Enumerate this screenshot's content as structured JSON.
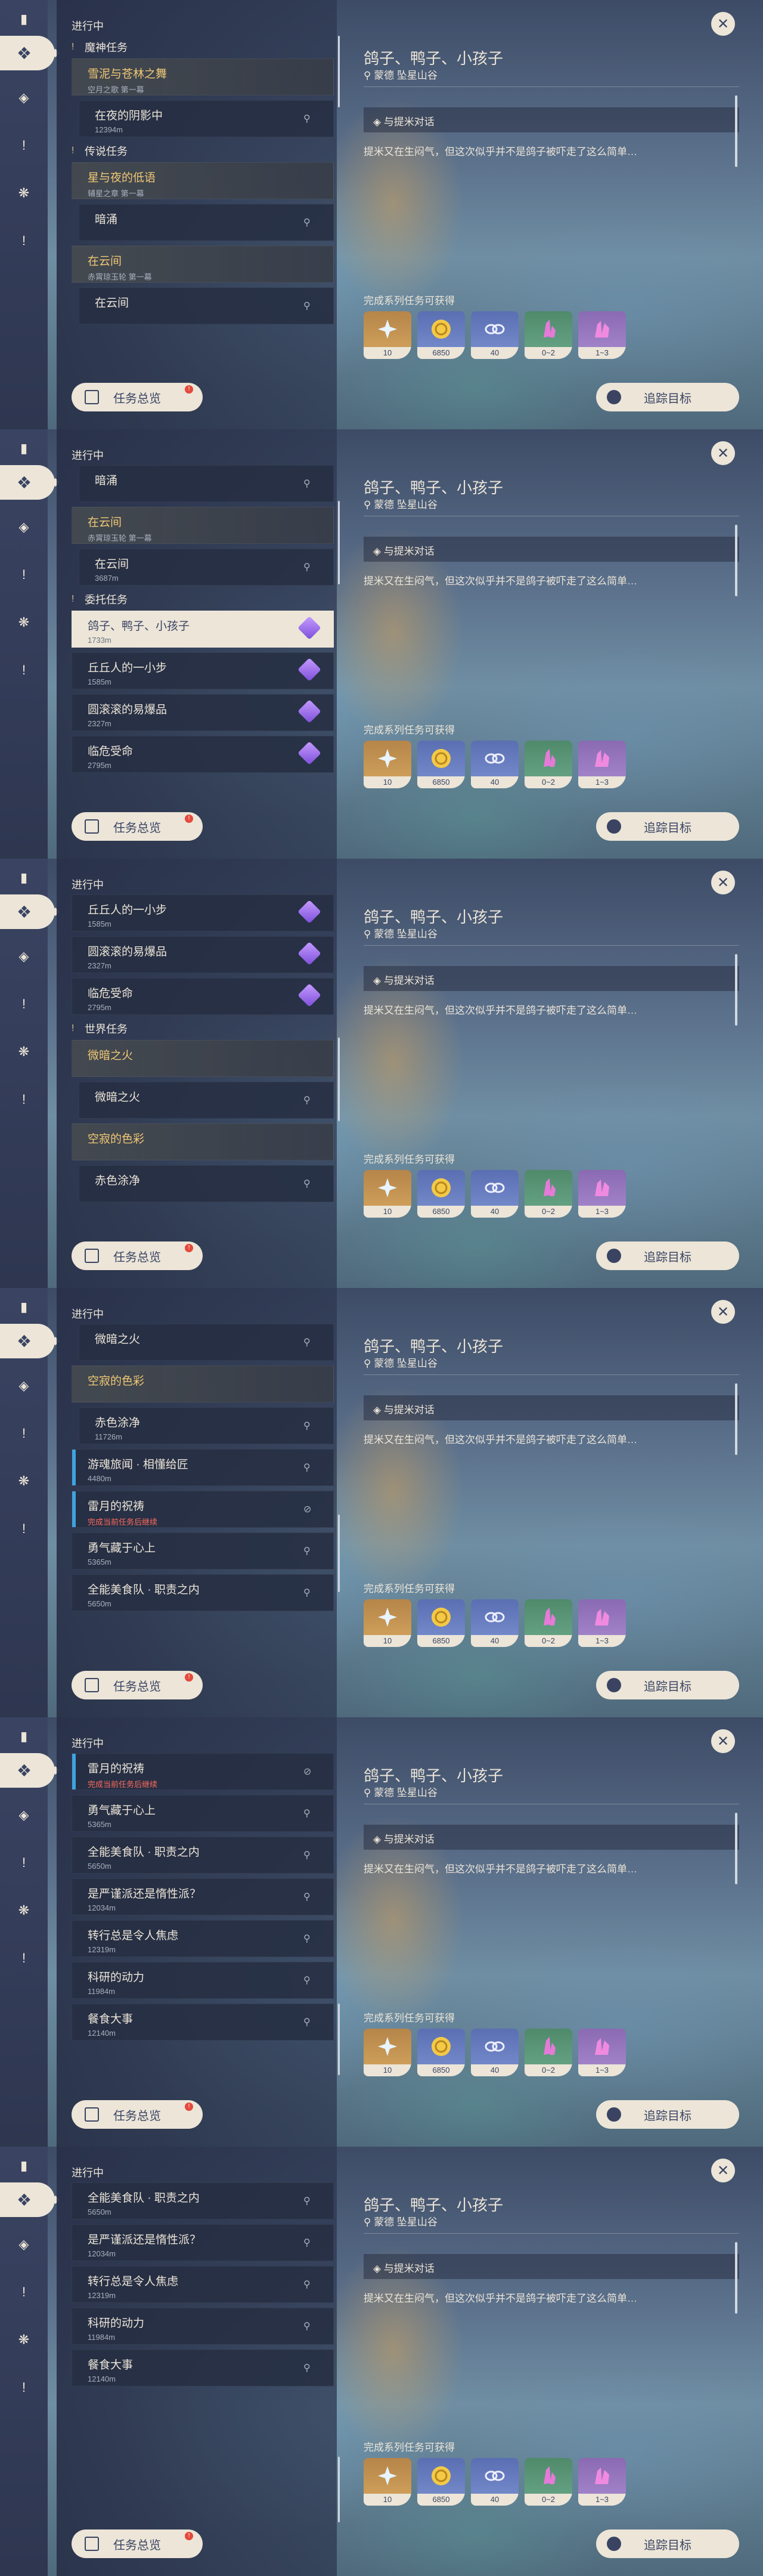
{
  "common": {
    "ongoing": "进行中",
    "tasks_button": "任务总览",
    "tasks_badge": "!",
    "track_button": "追踪目标",
    "close": "✕",
    "detail_title": "鸽子、鸭子、小孩子",
    "detail_location": "蒙德 坠星山谷",
    "objective": "与提米对话",
    "description": "提米又在生闷气，但这次似乎并不是鸽子被吓走了这么简单…",
    "rewards_title": "完成系列任务可获得",
    "rewards": [
      "10",
      "6850",
      "40",
      "0~2",
      "1~3"
    ]
  },
  "screens": [
    {
      "items": [
        {
          "kind": "sec",
          "label": "魔神任务"
        },
        {
          "kind": "story",
          "title": "雪泥与苍林之舞",
          "sub": "空月之歌 第一幕"
        },
        {
          "kind": "sub",
          "title": "在夜的阴影中",
          "sub": "12394m"
        },
        {
          "kind": "sec",
          "label": "传说任务"
        },
        {
          "kind": "story",
          "title": "星与夜的低语",
          "sub": "辅星之章 第一幕"
        },
        {
          "kind": "sub",
          "title": "暗涌",
          "sub": ""
        },
        {
          "kind": "story",
          "title": "在云间",
          "sub": "赤霄琼玉轮 第一幕"
        },
        {
          "kind": "sub",
          "title": "在云间",
          "sub": ""
        }
      ]
    },
    {
      "items": [
        {
          "kind": "sub",
          "title": "暗涌",
          "sub": ""
        },
        {
          "kind": "story",
          "title": "在云间",
          "sub": "赤霄琼玉轮 第一幕"
        },
        {
          "kind": "sub",
          "title": "在云间",
          "sub": "3687m"
        },
        {
          "kind": "sec",
          "label": "委托任务"
        },
        {
          "kind": "selgem",
          "title": "鸽子、鸭子、小孩子",
          "sub": "1733m"
        },
        {
          "kind": "gem",
          "title": "丘丘人的一小步",
          "sub": "1585m"
        },
        {
          "kind": "gem",
          "title": "圆滚滚的易爆品",
          "sub": "2327m"
        },
        {
          "kind": "gem",
          "title": "临危受命",
          "sub": "2795m"
        }
      ]
    },
    {
      "items": [
        {
          "kind": "gem",
          "title": "丘丘人的一小步",
          "sub": "1585m"
        },
        {
          "kind": "gem",
          "title": "圆滚滚的易爆品",
          "sub": "2327m"
        },
        {
          "kind": "gem",
          "title": "临危受命",
          "sub": "2795m"
        },
        {
          "kind": "sec",
          "label": "世界任务"
        },
        {
          "kind": "story",
          "title": "微暗之火",
          "sub": ""
        },
        {
          "kind": "sub",
          "title": "微暗之火",
          "sub": ""
        },
        {
          "kind": "story",
          "title": "空寂的色彩",
          "sub": ""
        },
        {
          "kind": "sub",
          "title": "赤色涂净",
          "sub": ""
        }
      ]
    },
    {
      "items": [
        {
          "kind": "sub",
          "title": "微暗之火",
          "sub": ""
        },
        {
          "kind": "story",
          "title": "空寂的色彩",
          "sub": ""
        },
        {
          "kind": "sub",
          "title": "赤色涂净",
          "sub": "11726m"
        },
        {
          "kind": "blue",
          "title": "游魂旅闻 · 相懂给匠",
          "sub": "4480m"
        },
        {
          "kind": "bluered",
          "title": "雷月的祝祷",
          "sub": "完成当前任务后继续"
        },
        {
          "kind": "plain",
          "title": "勇气藏于心上",
          "sub": "5365m"
        },
        {
          "kind": "plain",
          "title": "全能美食队 · 职责之内",
          "sub": "5650m"
        }
      ]
    },
    {
      "items": [
        {
          "kind": "bluered",
          "title": "雷月的祝祷",
          "sub": "完成当前任务后继续"
        },
        {
          "kind": "plain",
          "title": "勇气藏于心上",
          "sub": "5365m"
        },
        {
          "kind": "plain",
          "title": "全能美食队 · 职责之内",
          "sub": "5650m"
        },
        {
          "kind": "plain",
          "title": "是严谨派还是惰性派？",
          "sub": "12034m"
        },
        {
          "kind": "plain",
          "title": "转行总是令人焦虑",
          "sub": "12319m"
        },
        {
          "kind": "plain",
          "title": "科研的动力",
          "sub": "11984m"
        },
        {
          "kind": "plain",
          "title": "餐食大事",
          "sub": "12140m"
        }
      ]
    },
    {
      "items": [
        {
          "kind": "plain",
          "title": "全能美食队 · 职责之内",
          "sub": "5650m"
        },
        {
          "kind": "plain",
          "title": "是严谨派还是惰性派？",
          "sub": "12034m"
        },
        {
          "kind": "plain",
          "title": "转行总是令人焦虑",
          "sub": "12319m"
        },
        {
          "kind": "plain",
          "title": "科研的动力",
          "sub": "11984m"
        },
        {
          "kind": "plain",
          "title": "餐食大事",
          "sub": "12140m"
        }
      ]
    }
  ]
}
